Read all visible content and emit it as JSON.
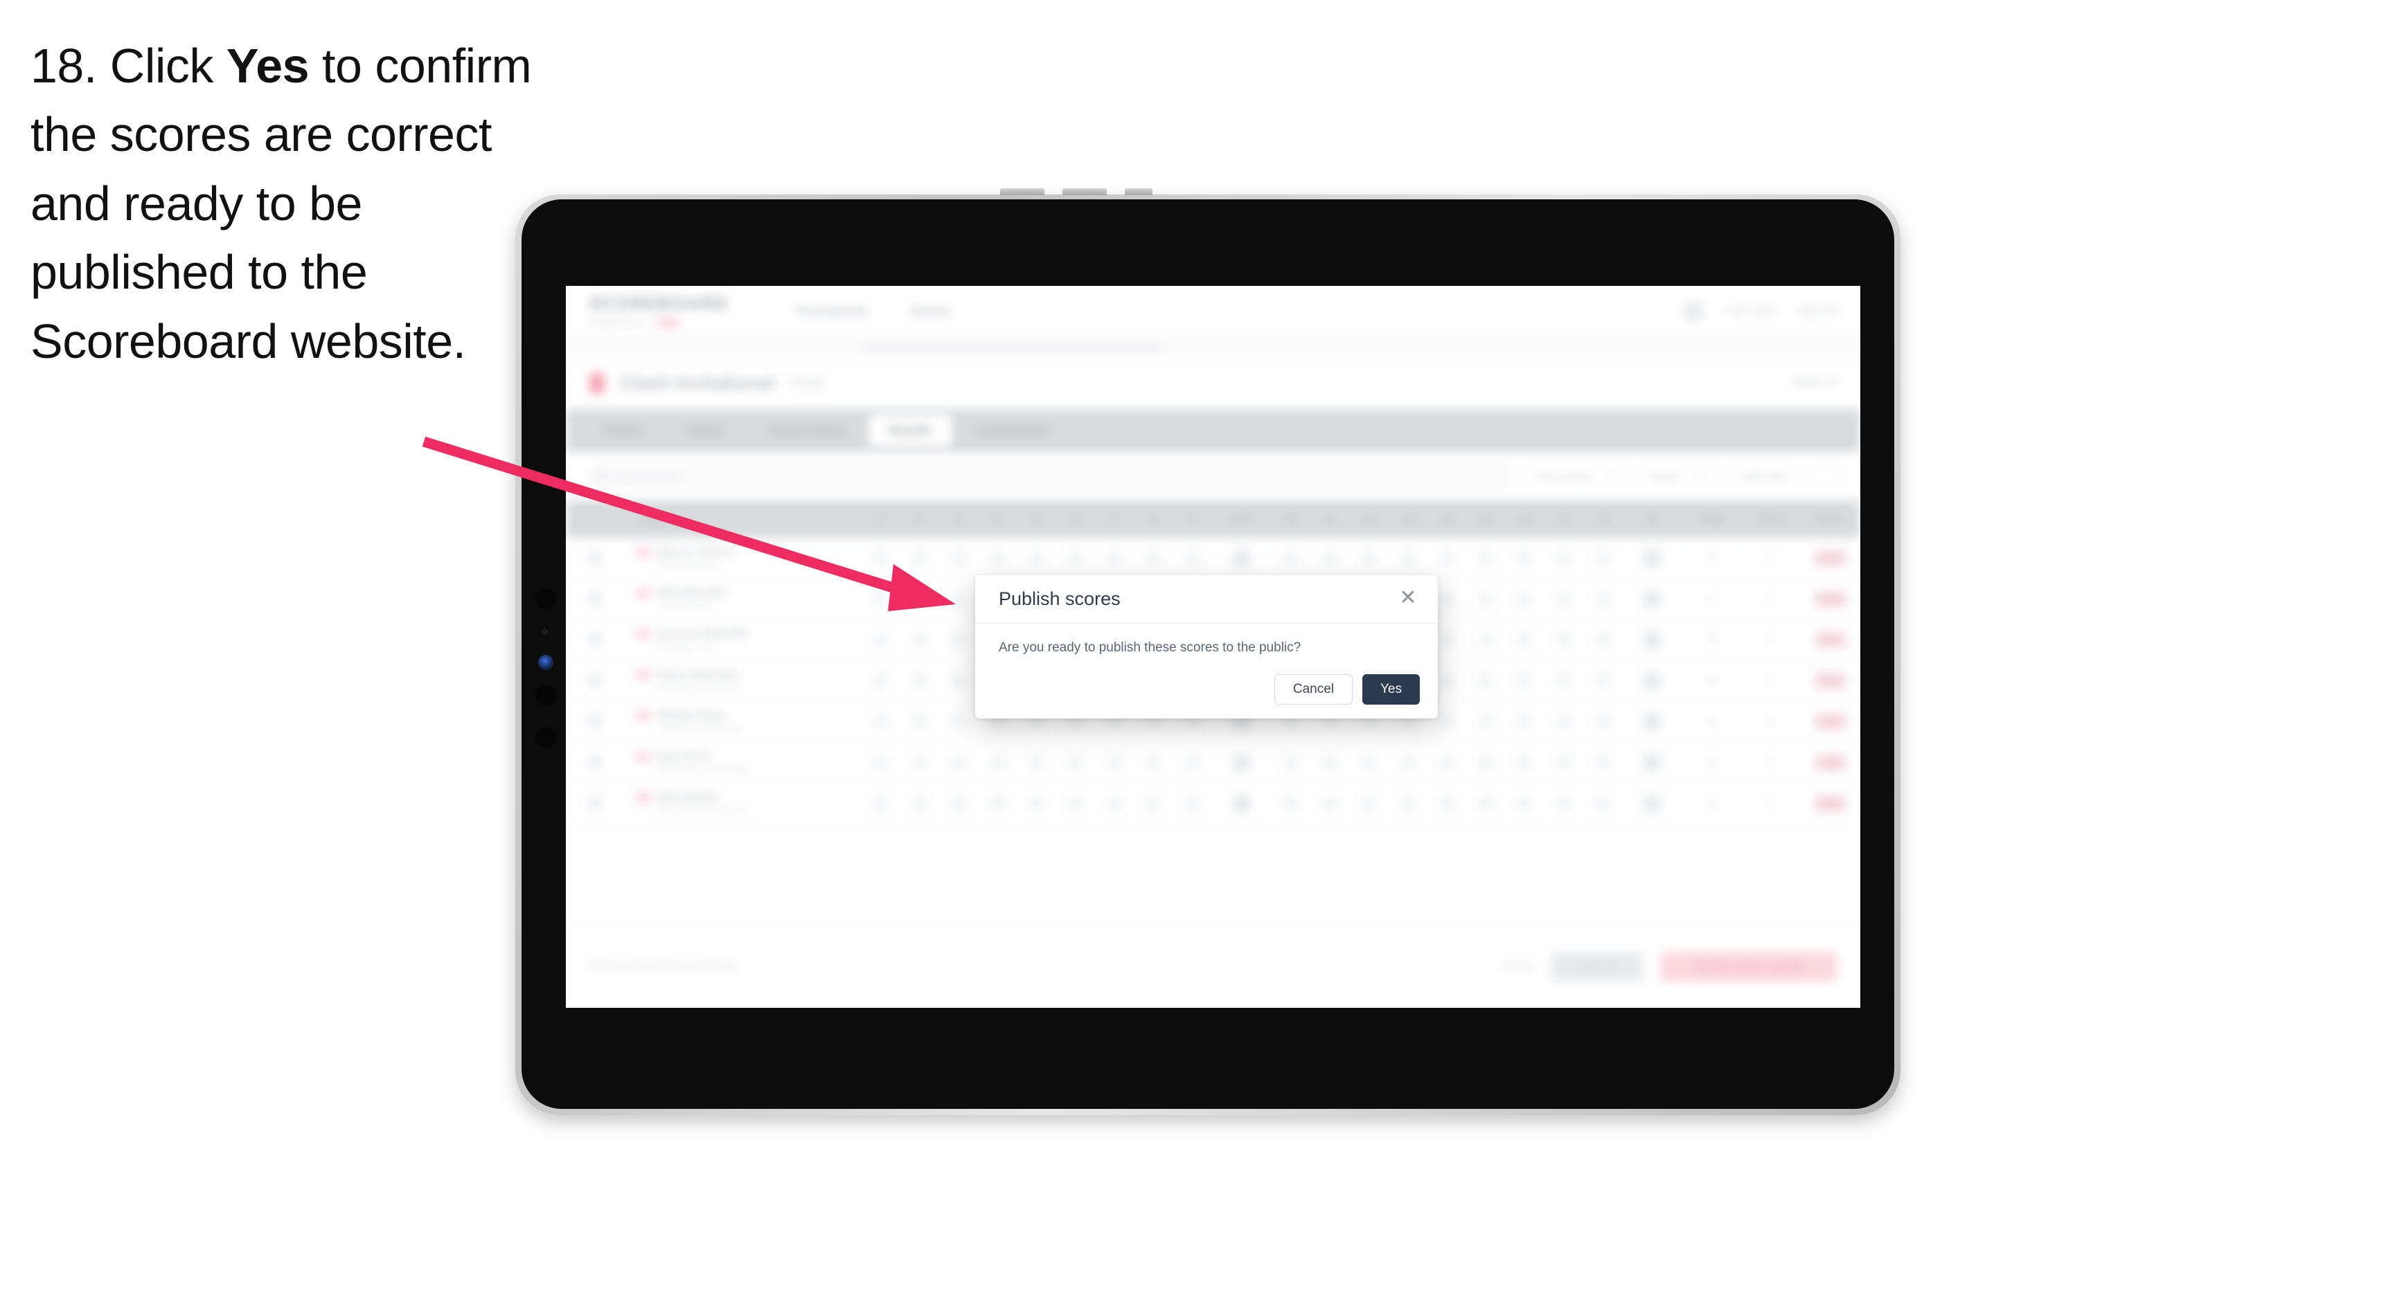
{
  "instruction": {
    "step_number": "18.",
    "before_bold": " Click ",
    "bold_word": "Yes",
    "after_bold": " to confirm the scores are correct and ready to be published to the Scoreboard website."
  },
  "colors": {
    "arrow": "#EE2C62",
    "modal_primary_button": "#2C3A4F",
    "brand_accent": "#F06292",
    "tablet_bezel": "#0C0C0C",
    "tablet_frame": "#D2D2D2"
  },
  "modal": {
    "title": "Publish scores",
    "close_glyph": "✕",
    "body": "Are you ready to publish these scores to the public?",
    "cancel_label": "Cancel",
    "confirm_label": "Yes"
  },
  "app": {
    "brand": {
      "word": "SCOREBOARD",
      "sub_text": "POWERED BY",
      "chip": "LIVE"
    },
    "nav": [
      "Tournaments",
      "Events"
    ],
    "header_right": {
      "icon": "bell-icon",
      "user": "Tom Lewis",
      "signout": "Sign out"
    },
    "event": {
      "title": "Clash Invitational",
      "round": "Final",
      "right_label": "Week 22"
    },
    "tabs": [
      {
        "label": "Details",
        "active": false
      },
      {
        "label": "Teams",
        "active": false
      },
      {
        "label": "Course Setup",
        "active": false
      },
      {
        "label": "Results",
        "active": true
      },
      {
        "label": "Leaderboard",
        "active": false
      }
    ],
    "filters": {
      "search_placeholder": "Search players",
      "dropdowns": [
        "Pick a round",
        "Report"
      ],
      "view_toggle": "Table view",
      "settings_icon": "settings-icon"
    },
    "table": {
      "columns": {
        "check": "",
        "player": "Player",
        "holes": [
          "1",
          "2",
          "3",
          "4",
          "5",
          "6",
          "7",
          "8",
          "9",
          "OUT",
          "10",
          "11",
          "12",
          "13",
          "14",
          "15",
          "16",
          "17",
          "18",
          "IN"
        ],
        "totals": [
          "Total",
          "Thru",
          "Score"
        ]
      },
      "rows": [
        {
          "player": "Marcus Tomson",
          "club": "Harlow Golf Club",
          "holes": [
            "4",
            "4",
            "3",
            "5",
            "4",
            "4",
            "3",
            "4",
            "4",
            "35",
            "4",
            "4",
            "3",
            "5",
            "4",
            "4",
            "3",
            "4",
            "4",
            "35"
          ],
          "total": "70",
          "thru": "F",
          "score": "-2",
          "to_par": "-2"
        },
        {
          "player": "Riley Marsden",
          "club": "Carnock Heath",
          "holes": [
            "4",
            "5",
            "3",
            "4",
            "4",
            "4",
            "3",
            "4",
            "4",
            "35",
            "4",
            "4",
            "3",
            "5",
            "4",
            "4",
            "4",
            "4",
            "4",
            "36"
          ],
          "total": "71",
          "thru": "F",
          "score": "-1",
          "to_par": "-1"
        },
        {
          "player": "Cameron Radcliffe",
          "club": "Pinewood Links",
          "holes": [
            "4",
            "4",
            "4",
            "5",
            "4",
            "4",
            "3",
            "4",
            "4",
            "36",
            "4",
            "4",
            "3",
            "5",
            "4",
            "4",
            "3",
            "5",
            "4",
            "36"
          ],
          "total": "72",
          "thru": "F",
          "score": "E",
          "to_par": "E"
        },
        {
          "player": "Oscar Waterman",
          "club": "Redbridge Golf Centre",
          "holes": [
            "5",
            "4",
            "3",
            "5",
            "4",
            "4",
            "4",
            "4",
            "4",
            "37",
            "4",
            "4",
            "3",
            "5",
            "4",
            "4",
            "3",
            "4",
            "5",
            "36"
          ],
          "total": "73",
          "thru": "F",
          "score": "+1",
          "to_par": "+1"
        },
        {
          "player": "William Sharp",
          "club": "Fairfield Park Golf Club",
          "holes": [
            "4",
            "5",
            "3",
            "5",
            "4",
            "5",
            "3",
            "4",
            "4",
            "37",
            "4",
            "5",
            "3",
            "5",
            "4",
            "4",
            "3",
            "4",
            "4",
            "36"
          ],
          "total": "73",
          "thru": "F",
          "score": "+1",
          "to_par": "+1"
        },
        {
          "player": "Ryan Brett",
          "club": "Westbrook Golf Academy",
          "holes": [
            "5",
            "4",
            "4",
            "5",
            "4",
            "4",
            "3",
            "5",
            "4",
            "38",
            "4",
            "4",
            "4",
            "5",
            "4",
            "4",
            "3",
            "4",
            "4",
            "36"
          ],
          "total": "74",
          "thru": "F",
          "score": "+2",
          "to_par": "+2"
        },
        {
          "player": "Nick Dunbar",
          "club": "Ashfield Heath Golf Club",
          "holes": [
            "5",
            "5",
            "3",
            "5",
            "4",
            "4",
            "4",
            "4",
            "4",
            "38",
            "4",
            "4",
            "4",
            "5",
            "5",
            "4",
            "3",
            "4",
            "4",
            "37"
          ],
          "total": "75",
          "thru": "F",
          "score": "+3",
          "to_par": "+3"
        }
      ]
    },
    "footer": {
      "note": "Scores published successfully",
      "link_label": "Cancel",
      "secondary_button": "Save all",
      "primary_button": "Publish scores to public"
    }
  }
}
